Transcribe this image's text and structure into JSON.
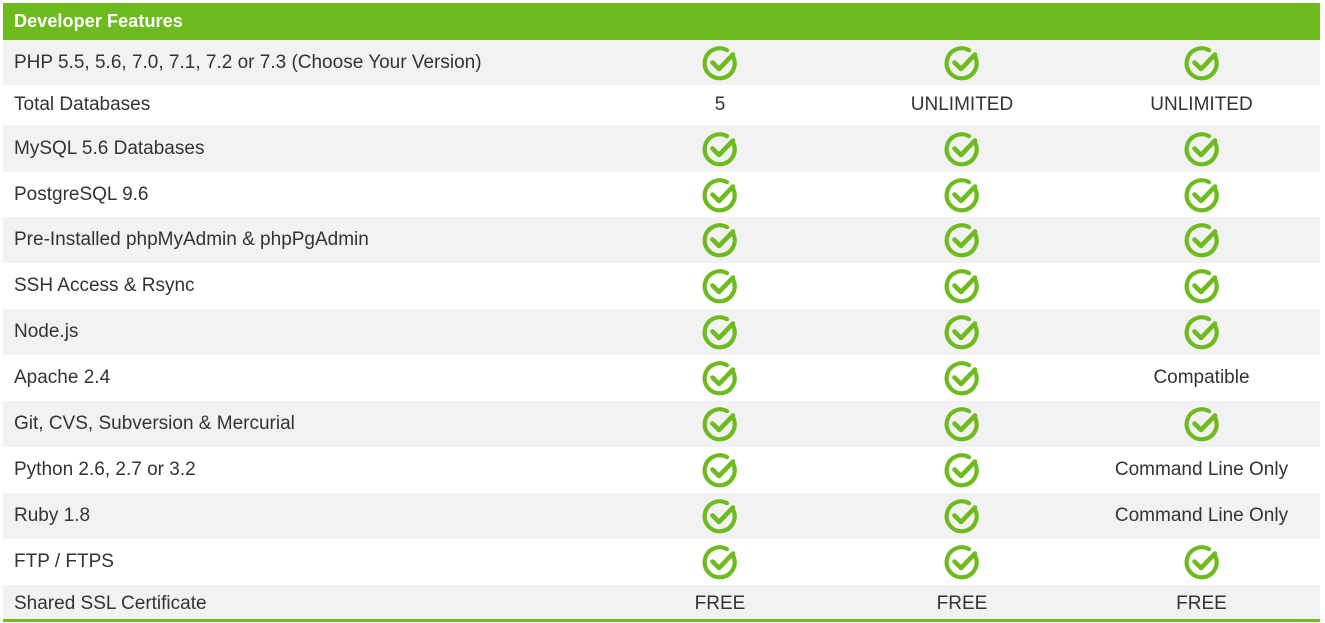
{
  "header": {
    "title": "Developer Features"
  },
  "colors": {
    "accent": "#6dbb1e",
    "row_alt": "#f2f2f2",
    "text": "#333333"
  },
  "icons": {
    "check": "check-circle-icon"
  },
  "rows": [
    {
      "label": "PHP 5.5, 5.6, 7.0, 7.1, 7.2 or 7.3 (Choose Your Version)",
      "values": [
        {
          "check": true
        },
        {
          "check": true
        },
        {
          "check": true
        }
      ]
    },
    {
      "label": "Total Databases",
      "values": [
        {
          "text": "5"
        },
        {
          "text": "UNLIMITED"
        },
        {
          "text": "UNLIMITED"
        }
      ]
    },
    {
      "label": "MySQL 5.6 Databases",
      "values": [
        {
          "check": true
        },
        {
          "check": true
        },
        {
          "check": true
        }
      ]
    },
    {
      "label": "PostgreSQL 9.6",
      "values": [
        {
          "check": true
        },
        {
          "check": true
        },
        {
          "check": true
        }
      ]
    },
    {
      "label": "Pre-Installed phpMyAdmin & phpPgAdmin",
      "values": [
        {
          "check": true
        },
        {
          "check": true
        },
        {
          "check": true
        }
      ]
    },
    {
      "label": "SSH Access & Rsync",
      "values": [
        {
          "check": true
        },
        {
          "check": true
        },
        {
          "check": true
        }
      ]
    },
    {
      "label": "Node.js",
      "values": [
        {
          "check": true
        },
        {
          "check": true
        },
        {
          "check": true
        }
      ]
    },
    {
      "label": "Apache 2.4",
      "values": [
        {
          "check": true
        },
        {
          "check": true
        },
        {
          "text": "Compatible"
        }
      ]
    },
    {
      "label": "Git, CVS, Subversion & Mercurial",
      "values": [
        {
          "check": true
        },
        {
          "check": true
        },
        {
          "check": true
        }
      ]
    },
    {
      "label": "Python 2.6, 2.7 or 3.2",
      "values": [
        {
          "check": true
        },
        {
          "check": true
        },
        {
          "text": "Command Line Only"
        }
      ]
    },
    {
      "label": "Ruby 1.8",
      "values": [
        {
          "check": true
        },
        {
          "check": true
        },
        {
          "text": "Command Line Only"
        }
      ]
    },
    {
      "label": "FTP / FTPS",
      "values": [
        {
          "check": true
        },
        {
          "check": true
        },
        {
          "check": true
        }
      ]
    },
    {
      "label": "Shared SSL Certificate",
      "values": [
        {
          "text": "FREE"
        },
        {
          "text": "FREE"
        },
        {
          "text": "FREE"
        }
      ]
    }
  ]
}
